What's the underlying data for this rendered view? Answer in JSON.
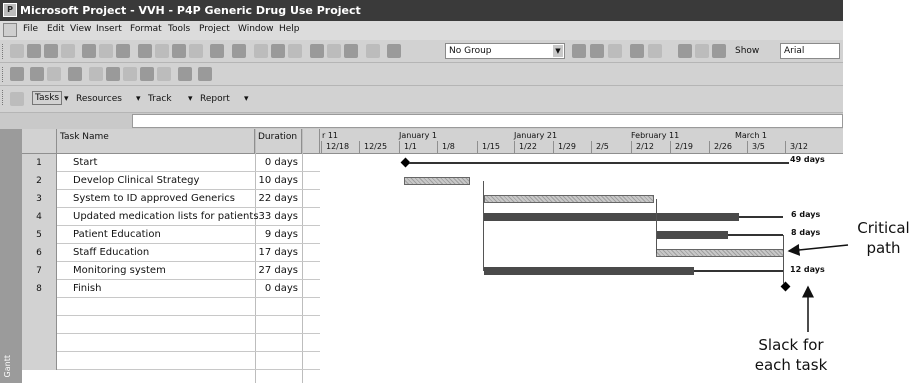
{
  "window": {
    "title": "Microsoft Project - VVH - P4P Generic Drug Use Project"
  },
  "menu": [
    "File",
    "Edit",
    "View",
    "Insert",
    "Format",
    "Tools",
    "Project",
    "Window",
    "Help"
  ],
  "toolbar": {
    "group_value": "No Group",
    "show_label": "Show",
    "font_value": "Arial"
  },
  "guide": {
    "items": [
      "Tasks",
      "Resources",
      "Track",
      "Report"
    ]
  },
  "columns": {
    "task_name": "Task Name",
    "duration": "Duration"
  },
  "tasks": [
    {
      "id": "1",
      "name": "Start",
      "duration": "0 days"
    },
    {
      "id": "2",
      "name": "Develop Clinical Strategy",
      "duration": "10 days"
    },
    {
      "id": "3",
      "name": "System to ID approved Generics",
      "duration": "22 days"
    },
    {
      "id": "4",
      "name": "Updated medication lists for patients",
      "duration": "33 days"
    },
    {
      "id": "5",
      "name": "Patient Education",
      "duration": "9 days"
    },
    {
      "id": "6",
      "name": "Staff Education",
      "duration": "17 days"
    },
    {
      "id": "7",
      "name": "Monitoring system",
      "duration": "27 days"
    },
    {
      "id": "8",
      "name": "Finish",
      "duration": "0 days"
    }
  ],
  "timescale": {
    "major": [
      "r 11",
      "January 1",
      "January 21",
      "February 11",
      "March 1"
    ],
    "minor": [
      "12/18",
      "12/25",
      "1/1",
      "1/8",
      "1/15",
      "1/22",
      "1/29",
      "2/5",
      "2/12",
      "2/19",
      "2/26",
      "3/5",
      "3/12"
    ]
  },
  "bar_labels": {
    "start": "49 days",
    "updated_lists": "6 days",
    "patient_education": "8 days",
    "monitoring": "12 days"
  },
  "viewbar": {
    "label": "Gantt"
  },
  "annotations": {
    "critical_path": "Critical path",
    "slack": "Slack for each task"
  },
  "colors": {
    "critical": "#4a4a4a",
    "noncritical": "#b0b0b0",
    "titlebar": "#3a3a3a"
  }
}
